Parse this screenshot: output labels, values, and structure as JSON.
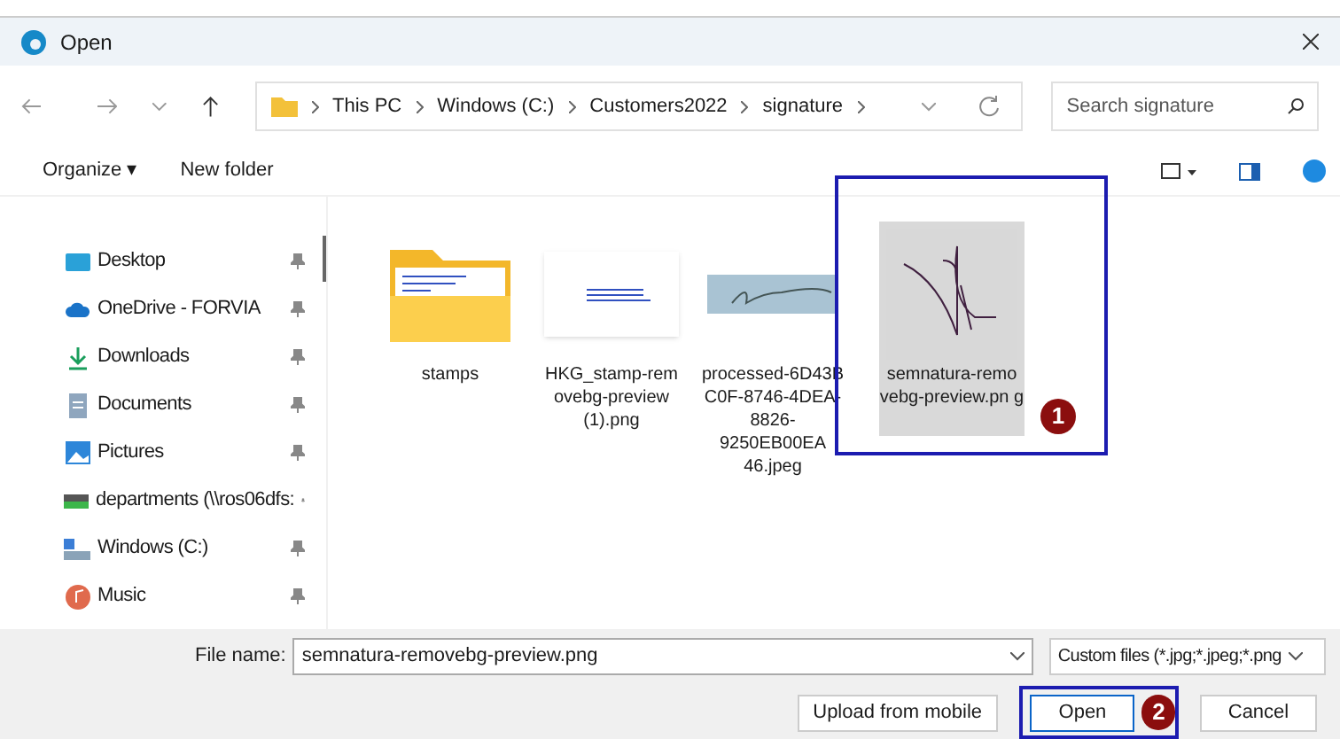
{
  "window": {
    "title": "Open"
  },
  "address": {
    "crumbs": [
      "This PC",
      "Windows (C:)",
      "Customers2022",
      "signature"
    ],
    "search_placeholder": "Search signature"
  },
  "toolbar": {
    "organize": "Organize ▾",
    "new_folder": "New folder"
  },
  "sidebar": {
    "items": [
      {
        "label": "Desktop",
        "kind": "desktop"
      },
      {
        "label": "OneDrive - FORVIA",
        "kind": "cloud"
      },
      {
        "label": "Downloads",
        "kind": "download"
      },
      {
        "label": "Documents",
        "kind": "document"
      },
      {
        "label": "Pictures",
        "kind": "picture"
      },
      {
        "label": "departments (\\\\ros06dfs:",
        "kind": "network"
      },
      {
        "label": "Windows (C:)",
        "kind": "drive"
      },
      {
        "label": "Music",
        "kind": "music"
      }
    ]
  },
  "files": [
    {
      "name": "stamps",
      "kind": "folder",
      "selected": false
    },
    {
      "name": "HKG_stamp-rem ovebg-preview (1).png",
      "kind": "stamp",
      "selected": false
    },
    {
      "name": "processed-6D43B C0F-8746-4DEA- 8826-9250EB00EA 46.jpeg",
      "kind": "scan",
      "selected": false
    },
    {
      "name": "semnatura-remo vebg-preview.pn g",
      "kind": "signature",
      "selected": true
    }
  ],
  "annotations": [
    "1",
    "2"
  ],
  "footer": {
    "file_name_label": "File name:",
    "file_name": "semnatura-removebg-preview.png",
    "filter": "Custom files (*.jpg;*.jpeg;*.png",
    "upload": "Upload from mobile",
    "open": "Open",
    "cancel": "Cancel"
  }
}
